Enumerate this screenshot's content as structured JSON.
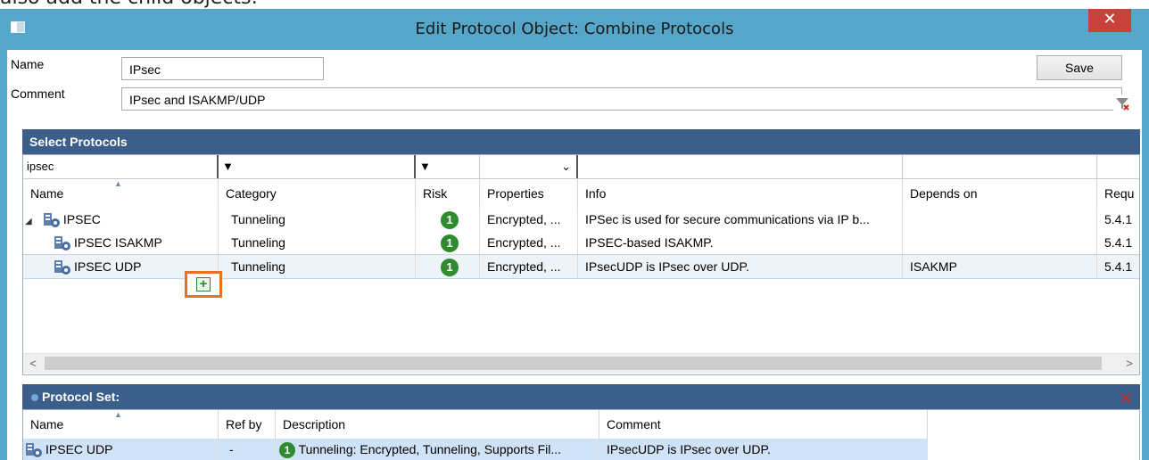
{
  "doc_text_above": "also add the child objects:",
  "window": {
    "title": "Edit Protocol Object: Combine Protocols",
    "close_glyph": "✕"
  },
  "form": {
    "name_label": "Name",
    "name_value": "IPsec",
    "comment_label": "Comment",
    "comment_value": "IPsec and ISAKMP/UDP",
    "save_label": "Save"
  },
  "select_protocols": {
    "title": "Select Protocols",
    "filters": {
      "name": "ipsec",
      "category_arrow": "▼",
      "risk_arrow": "▼",
      "properties_arrow": "⌄"
    },
    "columns": [
      "Name",
      "Category",
      "Risk",
      "Properties",
      "Info",
      "Depends on",
      "Requ"
    ],
    "sort_indicator": "▲",
    "rows": [
      {
        "expander": "◢",
        "name": "IPSEC",
        "category": "Tunneling",
        "risk": "1",
        "properties": "Encrypted, ...",
        "info": "IPSec is used for secure communications via IP b...",
        "depends_on": "",
        "req": "5.4.1"
      },
      {
        "name": "IPSEC ISAKMP",
        "category": "Tunneling",
        "risk": "1",
        "properties": "Encrypted, ...",
        "info": "IPSEC-based ISAKMP.",
        "depends_on": "",
        "req": "5.4.1"
      },
      {
        "name": "IPSEC UDP",
        "category": "Tunneling",
        "risk": "1",
        "properties": "Encrypted, ...",
        "info": "IPsecUDP is IPsec over UDP.",
        "depends_on": "ISAKMP",
        "req": "5.4.1"
      }
    ],
    "add_glyph": "+",
    "scroll_left": "<",
    "scroll_right": ">"
  },
  "protocol_set": {
    "title": "Protocol Set:",
    "columns": [
      "Name",
      "Ref by",
      "Description",
      "Comment"
    ],
    "sort_indicator": "▲",
    "rows": [
      {
        "name": "IPSEC UDP",
        "ref_by": "-",
        "risk": "1",
        "description": "Tunneling: Encrypted, Tunneling, Supports Fil...",
        "comment": "IPsecUDP is IPsec over UDP."
      }
    ],
    "remove_glyph": "✕"
  },
  "colors": {
    "titlebar": "#56a6c9",
    "panel_header": "#3b5e8a",
    "selected_row": "#dce9f7",
    "risk_low": "#2e8b2e",
    "highlight": "#e8721e"
  }
}
